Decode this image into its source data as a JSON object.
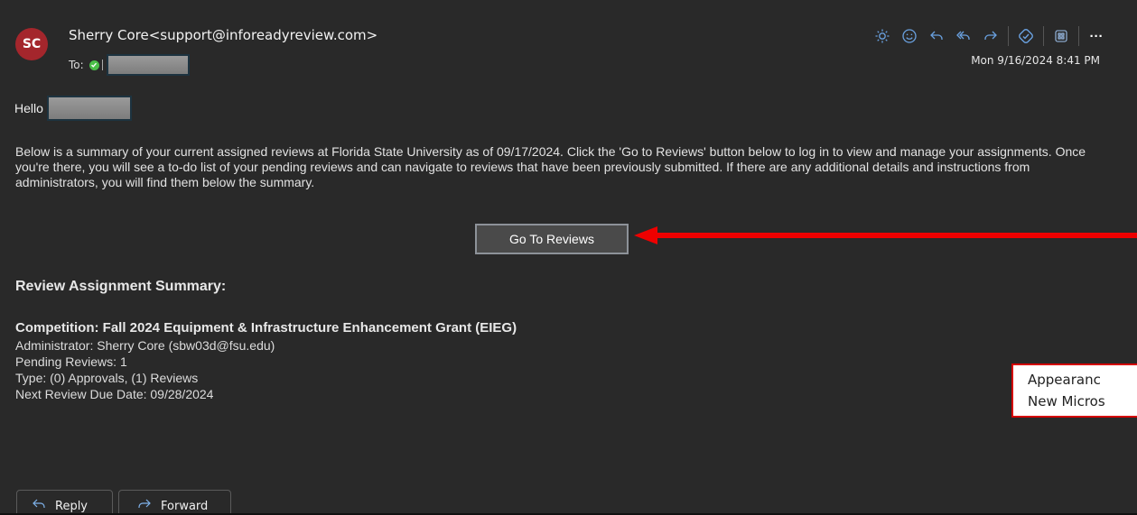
{
  "header": {
    "avatar_initials": "SC",
    "sender": "Sherry Core<support@inforeadyreview.com>",
    "to_label": "To:",
    "date": "Mon 9/16/2024 8:41 PM"
  },
  "toolbar": {
    "icons": [
      "sun-icon",
      "emoji-icon",
      "reply-icon",
      "reply-all-icon",
      "forward-icon",
      "loop-icon",
      "apps-icon",
      "more-icon"
    ],
    "more_label": "···"
  },
  "body": {
    "greeting": "Hello",
    "intro": "Below is a summary of your current assigned reviews at Florida State University as of 09/17/2024. Click the 'Go to Reviews' button below to log in to view and manage your assignments. Once you're there, you will see a to-do list of your pending reviews and can navigate to reviews that have been previously submitted. If there are any additional details and instructions from administrators, you will find them below the summary.",
    "go_button": "Go To Reviews",
    "summary_heading": "Review Assignment Summary:",
    "competition": "Competition: Fall 2024 Equipment & Infrastructure Enhancement Grant (EIEG)",
    "administrator": "Administrator: Sherry Core (sbw03d@fsu.edu)",
    "pending": "Pending Reviews: 1",
    "type": "Type: (0) Approvals, (1) Reviews",
    "due": "Next Review Due Date: 09/28/2024"
  },
  "callout": {
    "line1": "Appearanc",
    "line2": "New Micros",
    "border_color": "#d40000"
  },
  "footer": {
    "reply": "Reply",
    "forward": "Forward"
  },
  "colors": {
    "background": "#292929",
    "accent_icon": "#6aa1e0",
    "arrow": "#ee0000",
    "avatar": "#a4262c"
  }
}
